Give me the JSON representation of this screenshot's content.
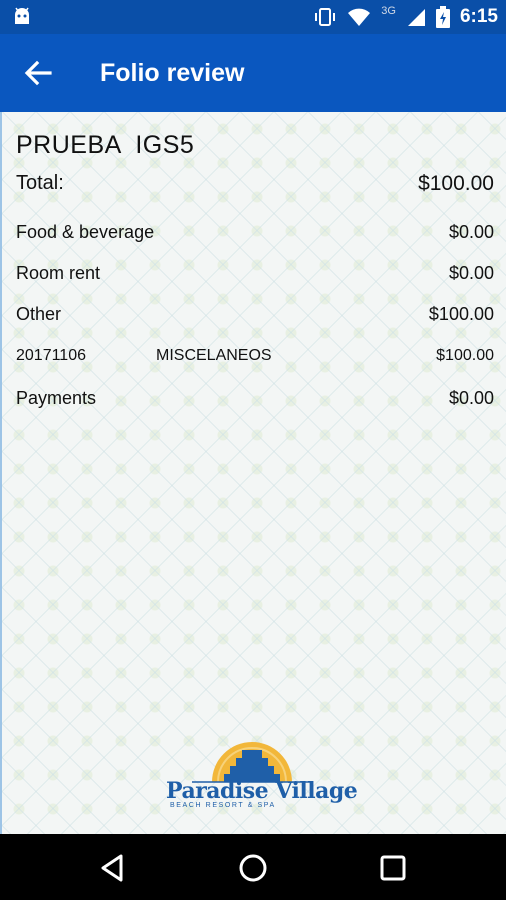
{
  "status_bar": {
    "time": "6:15",
    "network": "3G",
    "icons": [
      "android-icon",
      "vibrate-icon",
      "wifi-icon",
      "signal-icon",
      "battery-icon"
    ]
  },
  "app_bar": {
    "title": "Folio review",
    "back_icon": "arrow-back-icon"
  },
  "folio": {
    "guest_name": "PRUEBA  IGS5",
    "total_label": "Total:",
    "total_value": "$100.00",
    "sections": [
      {
        "label": "Food & beverage",
        "value": "$0.00"
      },
      {
        "label": "Room rent",
        "value": "$0.00"
      },
      {
        "label": "Other",
        "value": "$100.00"
      }
    ],
    "detail": {
      "date": "20171106",
      "description": "MISCELANEOS",
      "amount": "$100.00"
    },
    "payments_label": "Payments",
    "payments_value": "$0.00"
  },
  "logo": {
    "brand": "Paradise Village",
    "tagline": "BEACH RESORT & SPA"
  },
  "nav_bar": {
    "icons": [
      "back-triangle-icon",
      "home-circle-icon",
      "recents-square-icon"
    ]
  },
  "colors": {
    "status_bar": "#0a4fa8",
    "app_bar": "#0a57bf",
    "brand_blue": "#1f5fa8",
    "sun_yellow": "#f2b73a"
  }
}
